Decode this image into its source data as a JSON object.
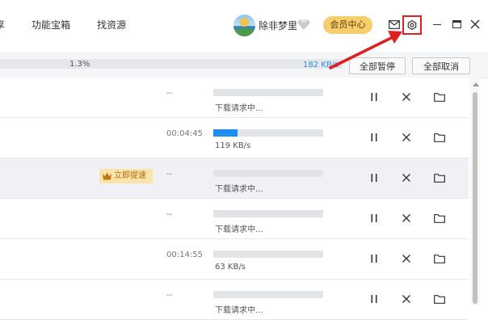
{
  "nav": {
    "partial_tab": "享",
    "tabs": [
      "功能宝箱",
      "找资源"
    ]
  },
  "user": {
    "name": "除非梦里",
    "vip_button": "会员中心"
  },
  "summary": {
    "progress_percent": "1.3%",
    "speed": "182 KB/s",
    "pause_all": "全部暂停",
    "cancel_all": "全部取消"
  },
  "tasks": [
    {
      "time": "--",
      "status": "下载请求中...",
      "progress": 0,
      "boost": ""
    },
    {
      "time": "00:04:45",
      "status": "119 KB/s",
      "progress": 0.22,
      "boost": ""
    },
    {
      "time": "--",
      "status": "下载请求中...",
      "progress": 0,
      "boost": "立即提速"
    },
    {
      "time": "--",
      "status": "下载请求中...",
      "progress": 0,
      "boost": ""
    },
    {
      "time": "00:14:55",
      "status": "63 KB/s",
      "progress": 0,
      "boost": ""
    },
    {
      "time": "--",
      "status": "下载请求中...",
      "progress": 0,
      "boost": ""
    }
  ],
  "colors": {
    "accent": "#1c8ff0",
    "vip": "#f6cf6c",
    "highlight": "#e02020"
  }
}
